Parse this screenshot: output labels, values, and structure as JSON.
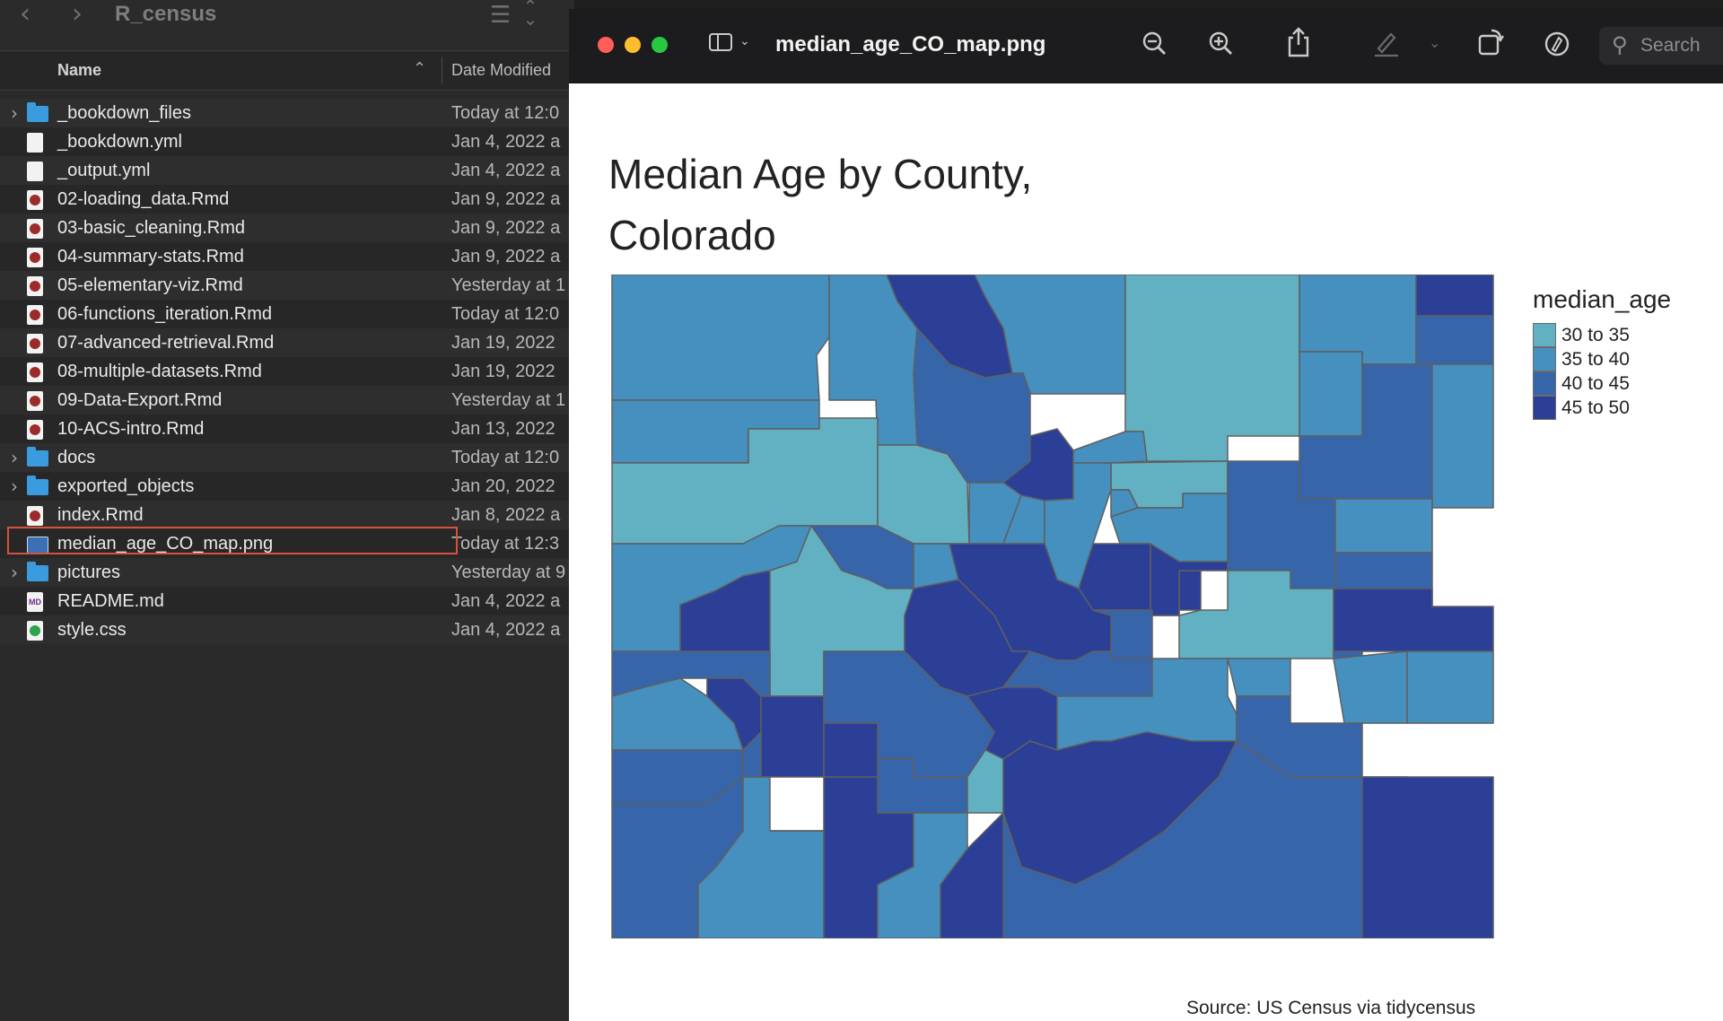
{
  "finder": {
    "back_icon": "‹",
    "forward_icon": "›",
    "folder_title": "R_census",
    "column_name": "Name",
    "column_date": "Date Modified",
    "files": [
      {
        "name": "_bookdown_files",
        "date": "Today at 12:0",
        "type": "folder",
        "expandable": true
      },
      {
        "name": "_bookdown.yml",
        "date": "Jan 4, 2022 a",
        "type": "doc",
        "expandable": false
      },
      {
        "name": "_output.yml",
        "date": "Jan 4, 2022 a",
        "type": "doc",
        "expandable": false
      },
      {
        "name": "02-loading_data.Rmd",
        "date": "Jan 9, 2022 a",
        "type": "rmd",
        "expandable": false
      },
      {
        "name": "03-basic_cleaning.Rmd",
        "date": "Jan 9, 2022 a",
        "type": "rmd",
        "expandable": false
      },
      {
        "name": "04-summary-stats.Rmd",
        "date": "Jan 9, 2022 a",
        "type": "rmd",
        "expandable": false
      },
      {
        "name": "05-elementary-viz.Rmd",
        "date": "Yesterday at 1",
        "type": "rmd",
        "expandable": false
      },
      {
        "name": "06-functions_iteration.Rmd",
        "date": "Today at 12:0",
        "type": "rmd",
        "expandable": false
      },
      {
        "name": "07-advanced-retrieval.Rmd",
        "date": "Jan 19, 2022",
        "type": "rmd",
        "expandable": false
      },
      {
        "name": "08-multiple-datasets.Rmd",
        "date": "Jan 19, 2022",
        "type": "rmd",
        "expandable": false
      },
      {
        "name": "09-Data-Export.Rmd",
        "date": "Yesterday at 1",
        "type": "rmd",
        "expandable": false
      },
      {
        "name": "10-ACS-intro.Rmd",
        "date": "Jan 13, 2022",
        "type": "rmd",
        "expandable": false
      },
      {
        "name": "docs",
        "date": "Today at 12:0",
        "type": "folder",
        "expandable": true
      },
      {
        "name": "exported_objects",
        "date": "Jan 20, 2022",
        "type": "folder",
        "expandable": true
      },
      {
        "name": "index.Rmd",
        "date": "Jan 8, 2022 a",
        "type": "rmd",
        "expandable": false
      },
      {
        "name": "median_age_CO_map.png",
        "date": "Today at 12:3",
        "type": "png",
        "expandable": false,
        "selected": true
      },
      {
        "name": "pictures",
        "date": "Yesterday at 9",
        "type": "folder",
        "expandable": true
      },
      {
        "name": "README.md",
        "date": "Jan 4, 2022 a",
        "type": "md",
        "expandable": false
      },
      {
        "name": "style.css",
        "date": "Jan 4, 2022 a",
        "type": "css",
        "expandable": false
      }
    ]
  },
  "preview": {
    "doc_title": "median_age_CO_map.png",
    "search_placeholder": "Search",
    "traffic_colors": {
      "close": "#ff5f57",
      "minimize": "#febc2e",
      "zoom": "#28c840"
    }
  },
  "map": {
    "title": "Median Age by County, Colorado",
    "legend_title": "median_age",
    "legend": [
      {
        "label": "30 to 35",
        "color": "#62b1c3"
      },
      {
        "label": "35 to 40",
        "color": "#4590be"
      },
      {
        "label": "40 to 45",
        "color": "#3765aa"
      },
      {
        "label": "45 to 50",
        "color": "#2b3f97"
      }
    ],
    "source": "Source: US Census via tidycensus"
  }
}
